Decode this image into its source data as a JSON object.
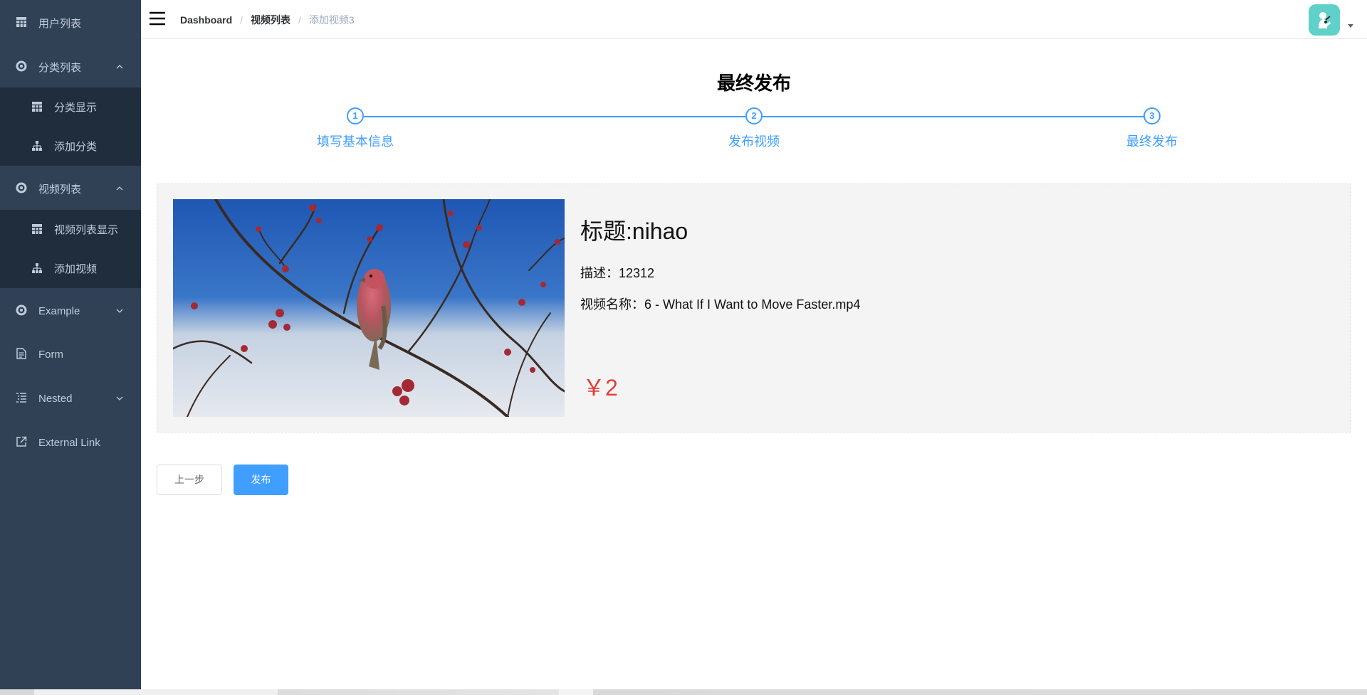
{
  "sidebar": {
    "items": [
      {
        "label": "用户列表",
        "icon": "table-icon"
      },
      {
        "label": "分类列表",
        "icon": "gear-icon",
        "expanded": true,
        "children": [
          {
            "label": "分类显示",
            "icon": "table-icon"
          },
          {
            "label": "添加分类",
            "icon": "tree-icon"
          }
        ]
      },
      {
        "label": "视频列表",
        "icon": "gear-icon",
        "expanded": true,
        "children": [
          {
            "label": "视频列表显示",
            "icon": "table-icon"
          },
          {
            "label": "添加视频",
            "icon": "tree-icon"
          }
        ]
      },
      {
        "label": "Example",
        "icon": "gear-icon",
        "expanded": false
      },
      {
        "label": "Form",
        "icon": "form-icon"
      },
      {
        "label": "Nested",
        "icon": "nested-icon",
        "expanded": false
      },
      {
        "label": "External Link",
        "icon": "external-link-icon"
      }
    ]
  },
  "navbar": {
    "breadcrumb": [
      "Dashboard",
      "视频列表",
      "添加视频3"
    ]
  },
  "main": {
    "title": "最终发布",
    "steps": [
      {
        "number": "1",
        "label": "填写基本信息"
      },
      {
        "number": "2",
        "label": "发布视频"
      },
      {
        "number": "3",
        "label": "最终发布"
      }
    ],
    "video": {
      "title": "标题:nihao",
      "description": "描述：12312",
      "file_name": "视频名称：6 - What If I Want to Move Faster.mp4",
      "price": "￥2"
    },
    "buttons": {
      "prev": "上一步",
      "publish": "发布"
    }
  },
  "colors": {
    "sidebar_bg": "#304156",
    "submenu_bg": "#1f2d3d",
    "accent": "#409eff",
    "price": "#e0403a",
    "avatar_bg": "#5fd1c8"
  }
}
